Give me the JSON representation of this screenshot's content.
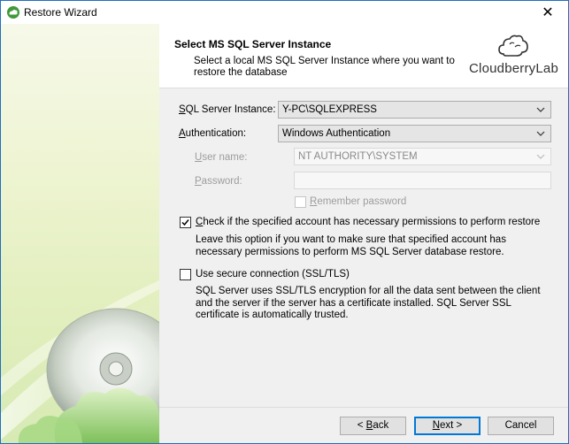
{
  "window": {
    "title": "Restore Wizard",
    "close_glyph": "✕"
  },
  "header": {
    "title": "Select MS SQL Server Instance",
    "subtitle": "Select a local MS SQL Server Instance where you want to restore the database",
    "logo_text": "CloudberryLab"
  },
  "form": {
    "sql_server_label_u": "S",
    "sql_server_label_rest": "QL Server Instance:",
    "sql_server_value": "Y-PC\\SQLEXPRESS",
    "auth_label_u": "A",
    "auth_label_rest": "uthentication:",
    "auth_value": "Windows Authentication",
    "username_label_u": "U",
    "username_label_rest": "ser name:",
    "username_value": "NT AUTHORITY\\SYSTEM",
    "password_label_u": "P",
    "password_label_rest": "assword:",
    "password_value": "",
    "remember_label_u": "R",
    "remember_label_rest": "emember password",
    "remember_checked": false,
    "check_perm_label_u": "C",
    "check_perm_label_rest": "heck if the specified account has necessary permissions to perform restore",
    "check_perm_checked": true,
    "check_perm_desc": "Leave this option if you want to make sure that specified account has necessary permissions to perform MS SQL Server database restore.",
    "secure_label": "Use secure connection (SSL/TLS)",
    "secure_checked": false,
    "secure_desc": "SQL Server uses SSL/TLS encryption for all the data sent between the client and the server if the server has a certificate installed. SQL Server SSL certificate is automatically trusted."
  },
  "footer": {
    "back_prefix": "< ",
    "back_u": "B",
    "back_rest": "ack",
    "next_u": "N",
    "next_rest": "ext >",
    "cancel_label": "Cancel"
  },
  "icons": {
    "app": "cloudberry-app-icon",
    "close": "close-icon",
    "dropdown": "chevron-down-icon",
    "check": "checkmark-icon",
    "logo": "cloud-logo-icon",
    "sidebar_art": "disc-illustration"
  },
  "colors": {
    "accent": "#0078d7",
    "sidebar": "#e3efbf"
  }
}
